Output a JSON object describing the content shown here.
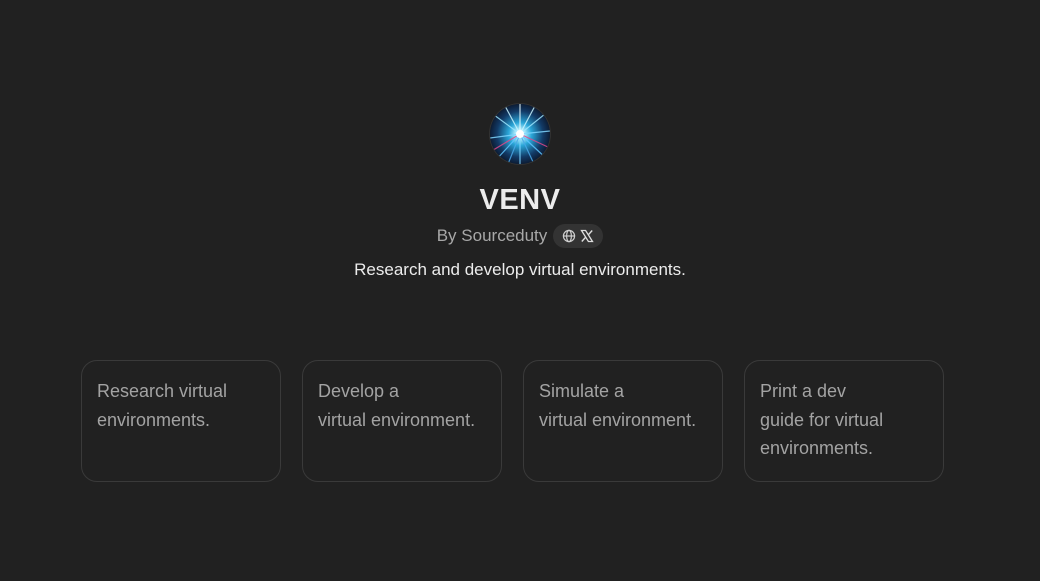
{
  "gpt": {
    "title": "VENV",
    "author": "By Sourceduty",
    "description": "Research and develop virtual environments.",
    "social_icons": [
      "globe-icon",
      "x-logo-icon"
    ]
  },
  "conversation_starters": [
    {
      "label": "Research virtual\nenvironments."
    },
    {
      "label": "Develop a\nvirtual environment."
    },
    {
      "label": "Simulate a\nvirtual environment."
    },
    {
      "label": "Print a dev\nguide for virtual\nenvironments."
    }
  ],
  "colors": {
    "background": "#212121",
    "card_border": "#3a3a3a",
    "muted_text": "#a3a3a3",
    "pill_background": "#333333"
  }
}
